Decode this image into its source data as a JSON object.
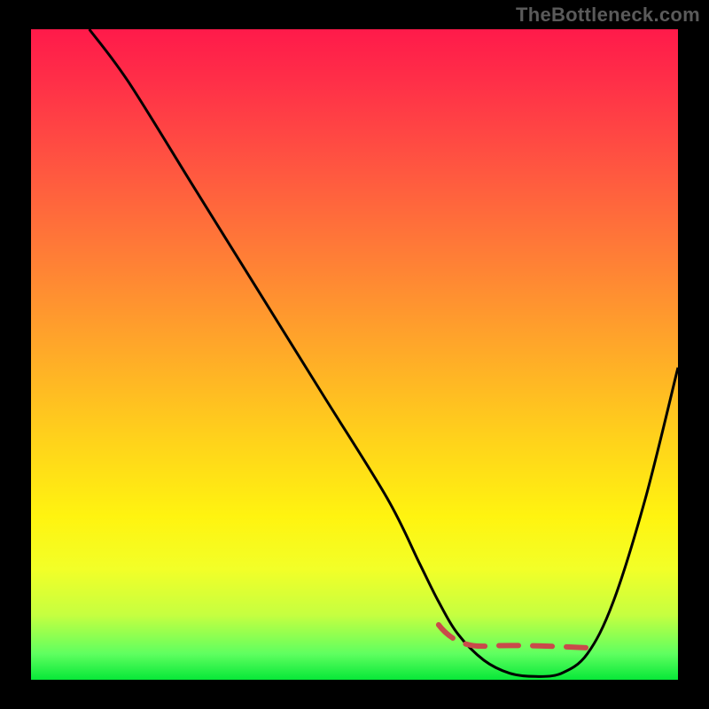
{
  "watermark": "TheBottleneck.com",
  "colors": {
    "background": "#000000",
    "watermark_text": "#5a5a5a",
    "curve_stroke": "#000000",
    "dash_stroke": "#c94a4a",
    "gradient_stops": [
      "#ff1a4a",
      "#ff2f48",
      "#ff5840",
      "#ff7e36",
      "#ffa52a",
      "#ffcf1c",
      "#fff410",
      "#f2ff28",
      "#c6ff40",
      "#5fff60",
      "#07e838"
    ]
  },
  "chart_data": {
    "type": "line",
    "title": "",
    "xlabel": "",
    "ylabel": "",
    "x_range": [
      0,
      100
    ],
    "y_range": [
      0,
      100
    ],
    "note": "Axes are unlabeled; x/y expressed as percent of plot width/height. y measured from bottom (0) to top (100).",
    "series": [
      {
        "name": "curve",
        "x": [
          9,
          15,
          25,
          35,
          45,
          55,
          60,
          63,
          66,
          70,
          74,
          78,
          82,
          86,
          90,
          95,
          100
        ],
        "y": [
          100,
          92,
          76,
          60,
          44,
          28,
          18,
          12,
          7,
          3,
          1,
          0.5,
          1,
          4,
          12,
          28,
          48
        ]
      }
    ],
    "optimal_band": {
      "description": "dashed segment near curve minimum",
      "x": [
        63,
        86
      ],
      "y": [
        4,
        4
      ]
    }
  }
}
